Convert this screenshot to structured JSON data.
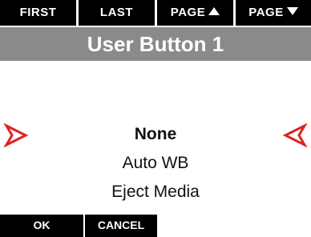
{
  "softkeys_top": {
    "first": "FIRST",
    "last": "LAST",
    "page_up": "PAGE",
    "page_down": "PAGE"
  },
  "title": "User Button 1",
  "menu": {
    "options": [
      "None",
      "Auto WB",
      "Eject Media"
    ],
    "selected_index": 0
  },
  "softkeys_bottom": {
    "ok": "OK",
    "cancel": "CANCEL"
  },
  "colors": {
    "bar": "#000000",
    "title_band": "#8a8a8a",
    "arrow": "#e02020"
  },
  "icons": {
    "page_up": "triangle-up-icon",
    "page_down": "triangle-down-icon",
    "left": "selector-left-arrow-icon",
    "right": "selector-right-arrow-icon"
  }
}
